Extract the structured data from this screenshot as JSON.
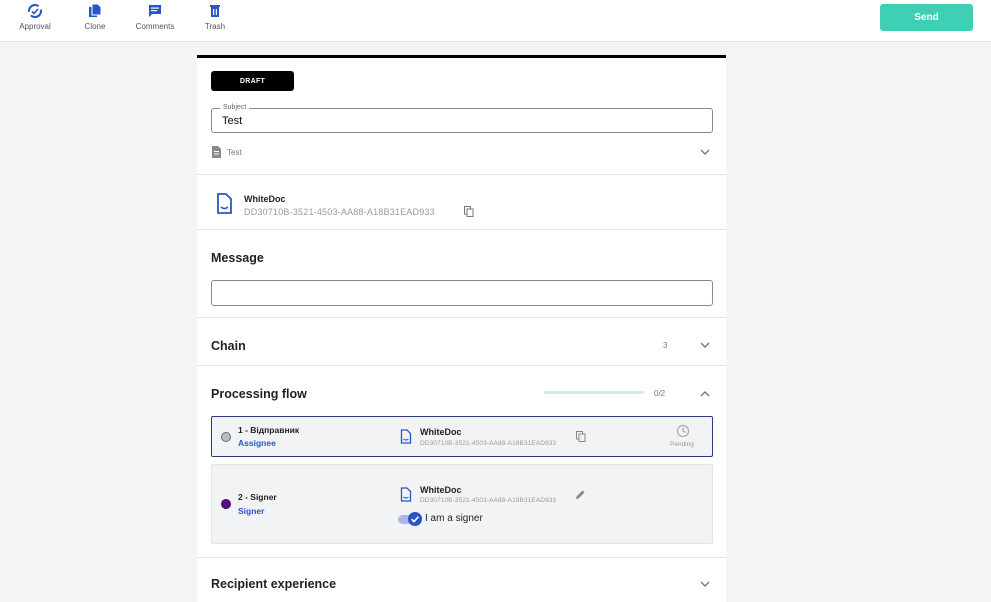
{
  "toolbar": {
    "items": [
      {
        "label": "Approval",
        "icon": "approval-sync-icon"
      },
      {
        "label": "Clone",
        "icon": "clone-icon"
      },
      {
        "label": "Comments",
        "icon": "comments-icon"
      },
      {
        "label": "Trash",
        "icon": "trash-icon"
      }
    ],
    "send_label": "Send"
  },
  "colors": {
    "accent": "#3ecfb4",
    "link_blue": "#2a55c8",
    "highlight_border": "#2c3a7a",
    "draft_badge": "#000000"
  },
  "document": {
    "status_badge": "DRAFT",
    "subject_label": "Subject",
    "subject_value": "Test",
    "file_name": "Test",
    "whitedoc": {
      "name": "WhiteDoc",
      "id": "DD30710B-3521-4503-AA88-A18B31EAD933"
    }
  },
  "sections": {
    "message": {
      "title": "Message",
      "value": ""
    },
    "chain": {
      "title": "Chain",
      "count": "3"
    },
    "processing_flow": {
      "title": "Processing flow",
      "progress_text": "0/2",
      "progress_fraction": 0.0,
      "steps": [
        {
          "label": "1 - Відправник",
          "role": "Assignee",
          "dot_color": "#b9bcc4",
          "doc_name": "WhiteDoc",
          "doc_id": "DD30710B-3521-4503-AA88-A18B31EAD933",
          "status": "Pending"
        },
        {
          "label": "2 - Signer",
          "role": "Signer",
          "dot_color": "#5a0e8a",
          "doc_name": "WhiteDoc",
          "doc_id": "DD30710B-3521-4503-AA88-A18B31EAD933",
          "toggle_label": "I am a signer",
          "toggle_on": true
        }
      ]
    },
    "recipient_experience": {
      "title": "Recipient experience"
    }
  }
}
